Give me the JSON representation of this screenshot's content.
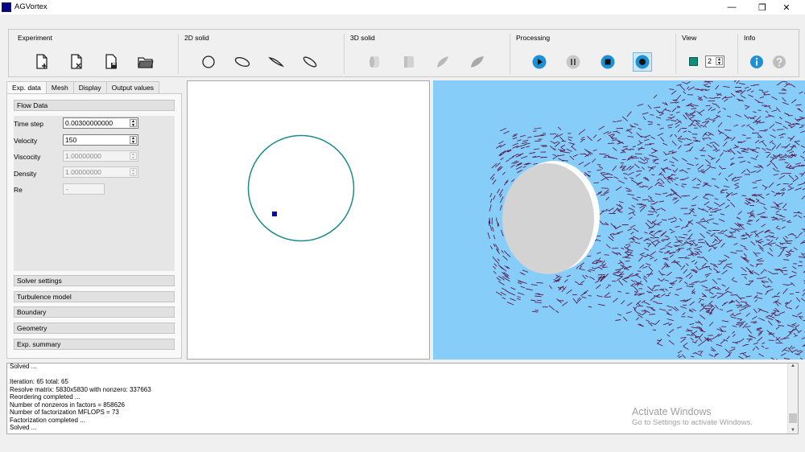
{
  "window": {
    "title": "AGVortex",
    "controls": {
      "minimize": "—",
      "maximize": "❐",
      "close": "✕"
    }
  },
  "toolbar": {
    "groups": [
      {
        "title": "Experiment",
        "tools": [
          "new-experiment-icon",
          "close-experiment-icon",
          "save-experiment-icon",
          "open-experiment-icon"
        ]
      },
      {
        "title": "2D solid",
        "tools": [
          "circle-icon",
          "ellipse-icon",
          "airfoil-icon",
          "tilted-ellipse-icon"
        ]
      },
      {
        "title": "3D solid",
        "tools": [
          "cylinder-icon",
          "box-icon",
          "wing-icon",
          "leaf-icon"
        ]
      },
      {
        "title": "Processing",
        "tools": [
          "play-icon",
          "pause-icon",
          "stop-icon",
          "record-icon"
        ]
      },
      {
        "title": "View",
        "tools": [
          "color-square-icon",
          "view-spinbox"
        ]
      },
      {
        "title": "Info",
        "tools": [
          "info-icon",
          "help-icon"
        ]
      }
    ],
    "view_value": "2"
  },
  "tabs": [
    "Exp. data",
    "Mesh",
    "Display",
    "Output values"
  ],
  "active_tab": 0,
  "flow_data": {
    "title": "Flow Data",
    "fields": [
      {
        "label": "Time step",
        "value": "0.00300000000",
        "enabled": true
      },
      {
        "label": "Velocity",
        "value": "150",
        "enabled": true
      },
      {
        "label": "Viscocity",
        "value": "1.00000000",
        "enabled": false
      },
      {
        "label": "Density",
        "value": "1.00000000",
        "enabled": false
      }
    ],
    "re": {
      "label": "Re",
      "value": "-"
    }
  },
  "sections": [
    "Solver settings",
    "Turbulence model",
    "Boundary",
    "Geometry",
    "Exp. summary"
  ],
  "log_lines": [
    "Solved ...",
    "",
    "Iteration: 65 total: 65",
    "Resolve matrix: 5830x5830 with nonzero: 337663",
    "Reordering completed ...",
    "Number of nonzeros in factors  = 858626",
    "Number of factorization MFLOPS = 73",
    "Factorization completed ...",
    "Solved ..."
  ],
  "watermark": {
    "title": "Activate Windows",
    "subtitle": "Go to Settings to activate Windows."
  },
  "colors": {
    "accent": "#1e90d6",
    "flow_bg": "#87cdfa",
    "streak": "#5a1f4e",
    "circle": "#1a8a8a",
    "marker": "#0a0aa0",
    "solid": "#d3d3d3"
  }
}
